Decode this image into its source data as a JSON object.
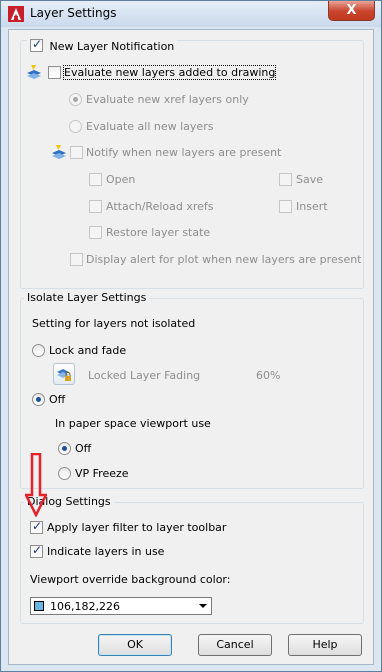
{
  "window": {
    "title": "Layer Settings",
    "close_glyph": "X",
    "app_icon": "autocad-icon"
  },
  "new_layer_notification": {
    "group_label": "New Layer Notification",
    "group_checked": true,
    "evaluate_label": "Evaluate new layers added to drawing",
    "evaluate_checked": false,
    "radio_xref_only": "Evaluate new xref layers only",
    "radio_all": "Evaluate all new layers",
    "notify_label": "Notify when new layers are present",
    "open_label": "Open",
    "save_label": "Save",
    "attach_label": "Attach/Reload xrefs",
    "insert_label": "Insert",
    "restore_label": "Restore layer state",
    "plot_label": "Display alert for plot when new layers are present"
  },
  "isolate": {
    "group_label": "Isolate Layer Settings",
    "subtitle": "Setting for layers not isolated",
    "lock_fade_label": "Lock and fade",
    "locked_fading_label": "Locked Layer Fading",
    "locked_fading_value": "60%",
    "off_label": "Off",
    "paper_space_label": "In paper space viewport use",
    "ps_off_label": "Off",
    "vp_freeze_label": "VP Freeze"
  },
  "dialog": {
    "group_label": "Dialog Settings",
    "apply_filter_label": "Apply layer filter to layer toolbar",
    "apply_filter_checked": true,
    "indicate_label": "Indicate layers in use",
    "indicate_checked": true,
    "viewport_bg_label": "Viewport override background color:",
    "color_value": "106,182,226",
    "color_hex": "#6ab6e2"
  },
  "buttons": {
    "ok": "OK",
    "cancel": "Cancel",
    "help": "Help"
  },
  "annotation": {
    "arrow_color": "#e8202a"
  }
}
